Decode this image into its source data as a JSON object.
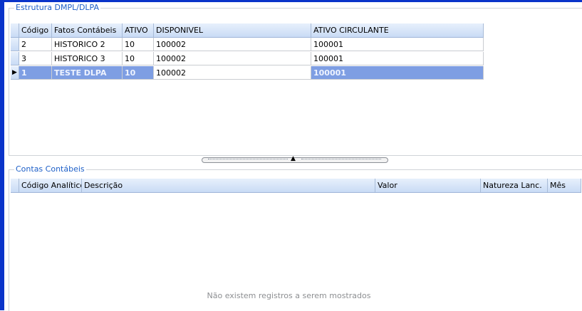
{
  "panel_top": {
    "title": "Estrutura DMPL/DLPA",
    "columns": [
      "Código",
      "Fatos Contábeis",
      "ATIVO",
      "DISPONIVEL",
      "ATIVO CIRCULANTE"
    ],
    "rows": [
      {
        "codigo": "2",
        "fatos": "HISTORICO 2",
        "ativo": "10",
        "disponivel": "100002",
        "circulante": "100001",
        "selected": false
      },
      {
        "codigo": "3",
        "fatos": "HISTORICO 3",
        "ativo": "10",
        "disponivel": "100002",
        "circulante": "100001",
        "selected": false
      },
      {
        "codigo": "1",
        "fatos": "TESTE DLPA",
        "ativo": "10",
        "disponivel": "100002",
        "circulante": "100001",
        "selected": true
      }
    ],
    "current_row_indicator": "▶"
  },
  "splitter": {
    "arrow": "▲",
    "dots": "………………………………………"
  },
  "panel_bottom": {
    "title": "Contas Contábeis",
    "columns": [
      "Código Analítico",
      "Descrição",
      "Valor",
      "Natureza Lanc.",
      "Mês"
    ],
    "empty_message": "Não existem registros a serem mostrados"
  },
  "colors": {
    "accent": "#0a34c9",
    "selected_row": "#7e9ee3",
    "group_title": "#1d5fc8"
  }
}
